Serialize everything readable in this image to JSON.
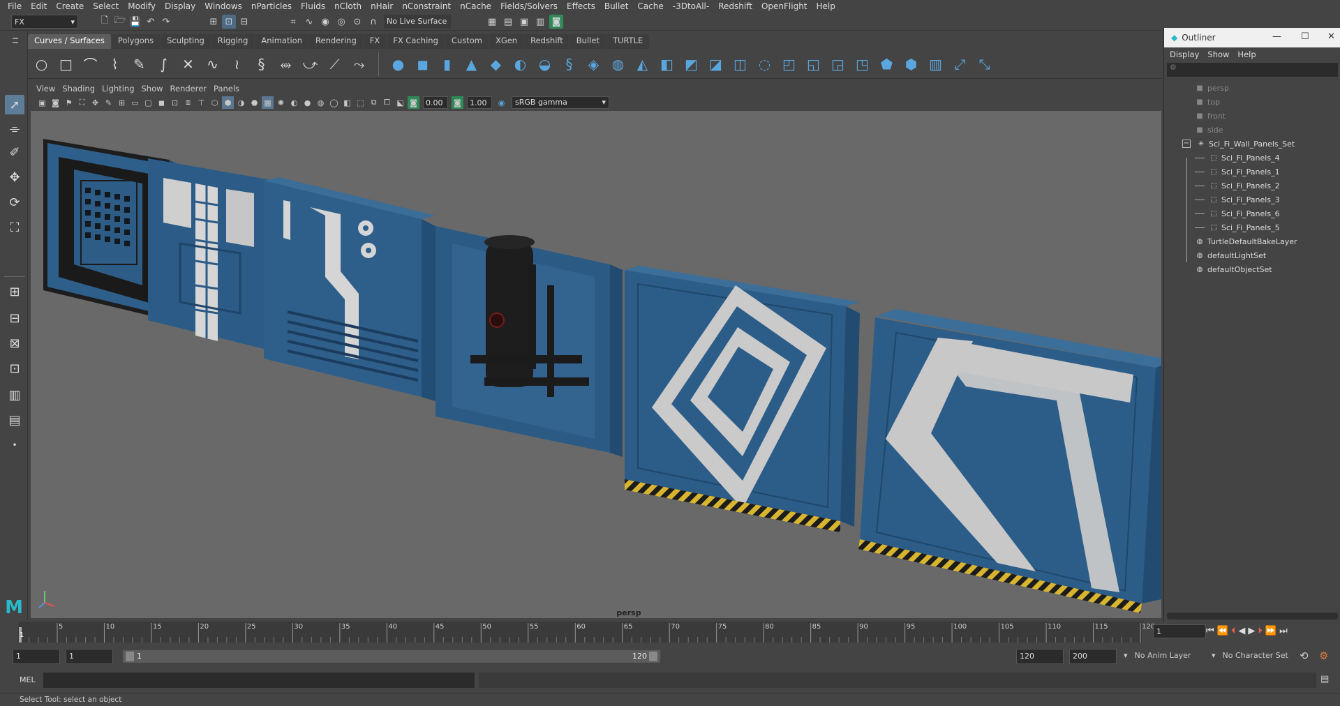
{
  "menubar": [
    "File",
    "Edit",
    "Create",
    "Select",
    "Modify",
    "Display",
    "Windows",
    "nParticles",
    "Fluids",
    "nCloth",
    "nHair",
    "nConstraint",
    "nCache",
    "Fields/Solvers",
    "Effects",
    "Bullet",
    "Cache",
    "-3DtoAll-",
    "Redshift",
    "OpenFlight",
    "Help"
  ],
  "status": {
    "menuset": "FX",
    "live_surface": "No Live Surface"
  },
  "shelf_tabs": [
    "Curves / Surfaces",
    "Polygons",
    "Sculpting",
    "Rigging",
    "Animation",
    "Rendering",
    "FX",
    "FX Caching",
    "Custom",
    "XGen",
    "Redshift",
    "Bullet",
    "TURTLE"
  ],
  "panel_menu": [
    "View",
    "Shading",
    "Lighting",
    "Show",
    "Renderer",
    "Panels"
  ],
  "panel_toolbar": {
    "exposure": "0.00",
    "gamma": "1.00",
    "colorspace": "sRGB gamma"
  },
  "viewport": {
    "camera": "persp"
  },
  "outliner": {
    "title": "Outliner",
    "menu": [
      "Display",
      "Show",
      "Help"
    ],
    "cameras": [
      "persp",
      "top",
      "front",
      "side"
    ],
    "set_name": "Sci_Fi_Wall_Panels_Set",
    "children": [
      "Sci_Fi_Panels_4",
      "Sci_Fi_Panels_1",
      "Sci_Fi_Panels_2",
      "Sci_Fi_Panels_3",
      "Sci_Fi_Panels_6",
      "Sci_Fi_Panels_5"
    ],
    "others": [
      "TurtleDefaultBakeLayer",
      "defaultLightSet",
      "defaultObjectSet"
    ]
  },
  "timeline": {
    "ticks": [
      "5",
      "10",
      "15",
      "20",
      "25",
      "30",
      "35",
      "40",
      "45",
      "50",
      "55",
      "60",
      "65",
      "70",
      "75",
      "80",
      "85",
      "90",
      "95",
      "100",
      "105",
      "110",
      "115",
      "120"
    ],
    "start_marker": "1",
    "current_frame": "1"
  },
  "range": {
    "start": "1",
    "start2": "1",
    "slider_start": "1",
    "slider_end": "120",
    "end": "120",
    "end2": "200",
    "anim_layer": "No Anim Layer",
    "char_set": "No Character Set"
  },
  "cmd": {
    "label": "MEL"
  },
  "help": "Select Tool: select an object"
}
